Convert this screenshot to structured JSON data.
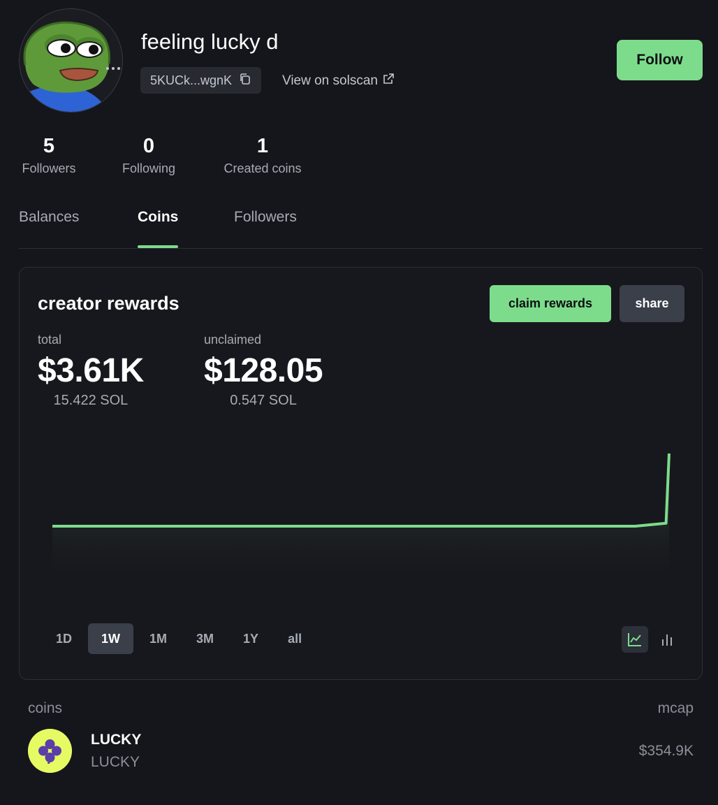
{
  "profile": {
    "username": "feeling lucky d",
    "address_short": "5KUCk...wgnK",
    "solscan_label": "View on solscan",
    "follow_label": "Follow"
  },
  "stats": [
    {
      "value": "5",
      "label": "Followers"
    },
    {
      "value": "0",
      "label": "Following"
    },
    {
      "value": "1",
      "label": "Created coins"
    }
  ],
  "tabs": [
    {
      "label": "Balances",
      "active": false
    },
    {
      "label": "Coins",
      "active": true
    },
    {
      "label": "Followers",
      "active": false
    }
  ],
  "rewards": {
    "title": "creator rewards",
    "claim_label": "claim rewards",
    "share_label": "share",
    "total": {
      "label": "total",
      "value": "$3.61K",
      "sol": "15.422 SOL"
    },
    "unclaimed": {
      "label": "unclaimed",
      "value": "$128.05",
      "sol": "0.547 SOL"
    },
    "ranges": [
      "1D",
      "1W",
      "1M",
      "3M",
      "1Y",
      "all"
    ],
    "active_range": "1W",
    "active_view": "line"
  },
  "colors": {
    "accent": "#7ddc8c",
    "background": "#15161b",
    "muted_text": "#a6abb5",
    "coin_logo_bg": "#e6fb63",
    "coin_logo_fg": "#5b3ea8"
  },
  "chart_data": {
    "type": "area",
    "values": [
      0.0,
      0.0,
      0.0,
      0.0,
      0.0,
      0.0,
      0.0,
      0.0,
      0.0,
      0.0,
      0.0,
      0.0,
      0.0,
      0.0,
      0.0,
      0.0,
      0.0,
      0.0,
      0.0,
      0.0,
      0.04,
      1.0
    ],
    "title": "",
    "xlabel": "",
    "ylabel": "",
    "grid": false
  },
  "coins": {
    "header_left": "coins",
    "header_right": "mcap",
    "items": [
      {
        "name": "LUCKY",
        "ticker": "LUCKY",
        "mcap": "$354.9K",
        "icon": "clover-icon"
      }
    ]
  }
}
